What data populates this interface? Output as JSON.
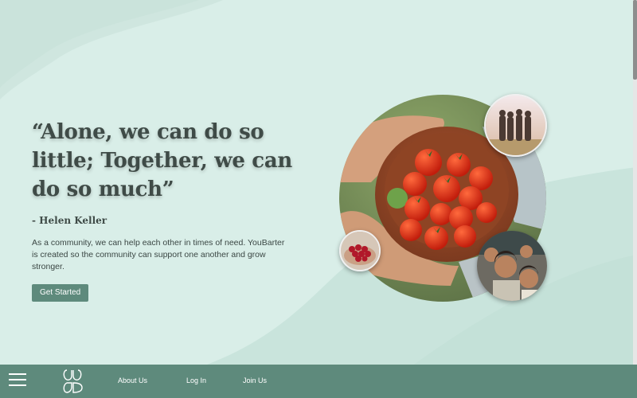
{
  "hero": {
    "quote": "“Alone, we can do so little; Together, we can do so much”",
    "author": "- Helen Keller",
    "description": "As a community, we can help each other in times of need. YouBarter is created so the community can support one another and grow stronger.",
    "cta_label": "Get Started"
  },
  "images": {
    "main": "tomatoes-bowl-photo",
    "people": "group-silhouette-photo",
    "berries": "berries-hands-photo",
    "kids": "children-smiling-photo"
  },
  "nav": {
    "items": [
      {
        "label": "About Us"
      },
      {
        "label": "Log In"
      },
      {
        "label": "Join Us"
      }
    ]
  },
  "colors": {
    "background": "#d9eee8",
    "accent": "#5e8a7c",
    "text": "#3f4b47"
  },
  "icons": {
    "menu": "hamburger-menu-icon",
    "logo": "youbarter-logo-icon"
  }
}
